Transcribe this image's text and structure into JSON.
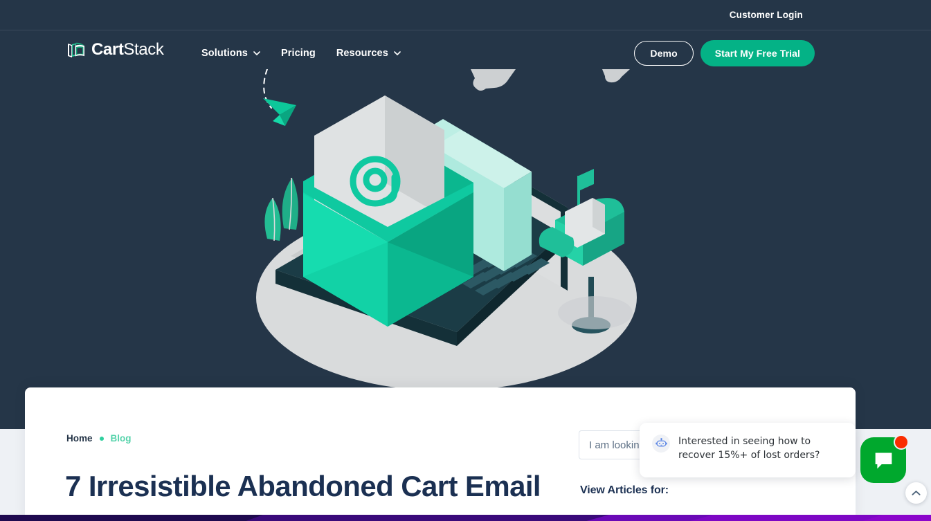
{
  "brand": {
    "logo_text_bold": "Cart",
    "logo_text_light": "Stack",
    "logo_icon": "cartstack-book-logo",
    "accent_green": "#04b286",
    "navy": "#253648",
    "title_navy": "#1b3052"
  },
  "topbar": {
    "customer_login": "Customer Login"
  },
  "nav": {
    "items": [
      {
        "label": "Solutions",
        "has_dropdown": true
      },
      {
        "label": "Pricing",
        "has_dropdown": false
      },
      {
        "label": "Resources",
        "has_dropdown": true
      }
    ],
    "demo_label": "Demo",
    "trial_label": "Start My Free Trial"
  },
  "hero": {
    "illustration": "isometric-laptop-email-mailbox-illustration"
  },
  "breadcrumb": {
    "home": "Home",
    "current": "Blog"
  },
  "article": {
    "title": "7 Irresistible Abandoned Cart Email"
  },
  "search": {
    "placeholder": "I am looking for...",
    "value": ""
  },
  "sidebar": {
    "view_articles_label": "View Articles for:"
  },
  "chat": {
    "message": "Interested in seeing how to recover 15%+ of lost orders?",
    "bot_icon": "robot-icon",
    "launcher_icon": "chat-bubble-icon",
    "launcher_color": "#00a82d",
    "badge_color": "#fa2d00"
  },
  "to_top": {
    "icon": "chevron-up-icon"
  },
  "progress_bar": {
    "colors": [
      "#1f0a4f",
      "#2e0a64",
      "#5b0bad",
      "#7a07c2",
      "#8a07c8"
    ]
  }
}
